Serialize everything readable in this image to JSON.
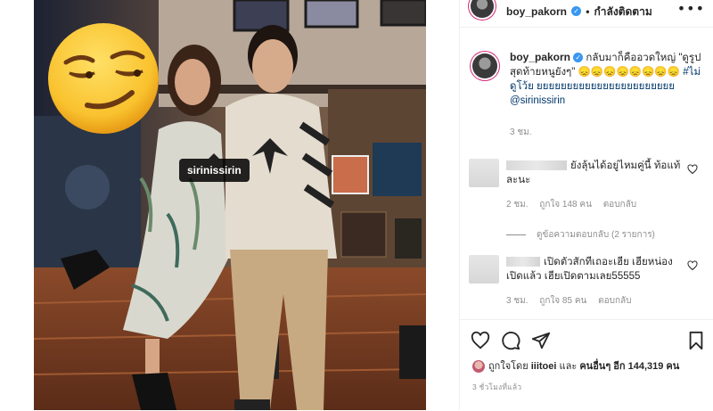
{
  "post": {
    "tag": "sirinissirin"
  },
  "header": {
    "username": "boy_pakorn",
    "separator": "•",
    "follow_state": "กำลังติดตาม",
    "more": "•••"
  },
  "caption": {
    "username": "boy_pakorn",
    "text": "กลับมาก็คืออวดใหญ่ \"ดูรูปสุดท้ายหนูยังๆ\" 😞😞😞😞😞😞😞😞",
    "hashtag": "#ไม่ดูโว้ย",
    "hashtag_tail": "ยยยยยยยยยยยยยยยยยยยยยยย",
    "mention": "@sirinissirin",
    "time": "3 ชม."
  },
  "comments": [
    {
      "text": "ยังลุ้นได้อยู่ไหมคู่นี้ ท้อแท้ละนะ",
      "time": "2 ชม.",
      "likes": "ถูกใจ 148 คน",
      "reply": "ตอบกลับ"
    },
    {
      "text": "เปิดตัวสักทีเถอะเฮีย เฮียหน่องเปิดแล้ว เฮียเปิดตามเลย55555",
      "time": "3 ชม.",
      "likes": "ถูกใจ 85 คน",
      "reply": "ตอบกลับ"
    }
  ],
  "view_replies": "ดูข้อความตอบกลับ (2 รายการ)",
  "likes": {
    "prefix": "ถูกใจโดย",
    "user": "iiitoei",
    "middle": "และ",
    "others": "คนอื่นๆ อีก 144,319 คน"
  },
  "time_ago": "3 ชั่วโมงที่แล้ว",
  "colors": {
    "verified": "#3897f0",
    "link": "#00376b",
    "muted": "#8e8e8e",
    "border": "#efefef"
  }
}
